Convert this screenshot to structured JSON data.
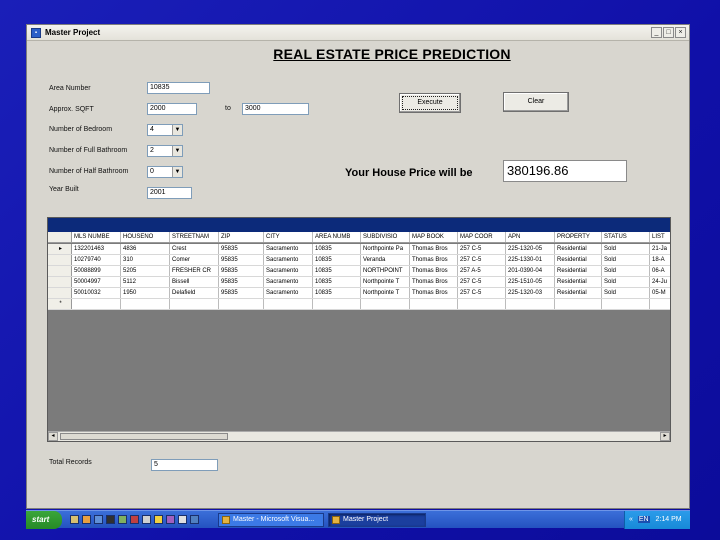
{
  "window": {
    "title": "Master Project",
    "buttons": [
      "_",
      "□",
      "×"
    ]
  },
  "heading": "REAL ESTATE PRICE PREDICTION",
  "form": {
    "area_label": "Area Number",
    "area_value": "10835",
    "sqft_label": "Approx. SQFT",
    "sqft_from": "2000",
    "to_label": "to",
    "sqft_to": "3000",
    "bedroom_label": "Number of Bedroom",
    "bedroom_value": "4",
    "fullbath_label": "Number of Full Bathroom",
    "fullbath_value": "2",
    "halfbath_label": "Number of Half Bathroom",
    "halfbath_value": "0",
    "year_label": "Year Built",
    "year_value": "2001"
  },
  "buttons": {
    "execute": "Execute",
    "clear": "Clear"
  },
  "result": {
    "label": "Your House Price will be",
    "value": "380196.86"
  },
  "grid": {
    "columns": [
      "MLS NUMBE",
      "HOUSENO",
      "STREETNAM",
      "ZIP",
      "CITY",
      "AREA NUMB",
      "SUBDIVISIO",
      "MAP BOOK",
      "MAP COOR",
      "APN",
      "PROPERTY",
      "STATUS",
      "LIST"
    ],
    "rows": [
      {
        "marker": "▸",
        "cells": [
          "132201463",
          "4836",
          "Crest",
          "95835",
          "Sacramento",
          "10835",
          "Northpointe Pa",
          "Thomas Bros",
          "257 C-5",
          "225-1320-05",
          "Residential",
          "Sold",
          "21-Ja"
        ]
      },
      {
        "marker": "",
        "cells": [
          "10279740",
          "310",
          "Comer",
          "95835",
          "Sacramento",
          "10835",
          "Veranda",
          "Thomas Bros",
          "257 C-5",
          "225-1330-01",
          "Residential",
          "Sold",
          "18-A"
        ]
      },
      {
        "marker": "",
        "cells": [
          "50088899",
          "5205",
          "FRESHER CR",
          "95835",
          "Sacramento",
          "10835",
          "NORTHPOINT",
          "Thomas Bros",
          "257 A-5",
          "201-0390-04",
          "Residential",
          "Sold",
          "06-A"
        ]
      },
      {
        "marker": "",
        "cells": [
          "50004997",
          "5112",
          "Bissell",
          "95835",
          "Sacramento",
          "10835",
          "Northpointe T",
          "Thomas Bros",
          "257 C-5",
          "225-1510-05",
          "Residential",
          "Sold",
          "24-Ju"
        ]
      },
      {
        "marker": "",
        "cells": [
          "50010032",
          "1950",
          "Delafield",
          "95835",
          "Sacramento",
          "10835",
          "Northpointe T",
          "Thomas Bros",
          "257 C-5",
          "225-1320-03",
          "Residential",
          "Sold",
          "05-M"
        ]
      },
      {
        "marker": "*",
        "cells": [
          "",
          "",
          "",
          "",
          "",
          "",
          "",
          "",
          "",
          "",
          "",
          "",
          ""
        ]
      }
    ]
  },
  "footer": {
    "total_label": "Total Records",
    "total_value": "5"
  },
  "taskbar": {
    "start": "start",
    "tasks": [
      "Master - Microsoft Visua...",
      "Master Project"
    ],
    "clock": "2:14 PM",
    "tray_text": "«",
    "tray_lang": "EN"
  }
}
